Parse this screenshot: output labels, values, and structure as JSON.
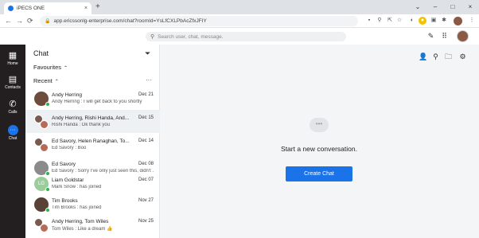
{
  "browser": {
    "tab_title": "iPECS ONE",
    "tab_close": "×",
    "new_tab": "+",
    "url": "app.ericssonlg-enterprise.com/chat?roomId=YsLfCXLPbAcZfxJFIY",
    "window_controls": [
      "⌄",
      "–",
      "□",
      "×"
    ]
  },
  "header": {
    "search_placeholder": "Search user, chat, message."
  },
  "rail": {
    "items": [
      {
        "label": "Home",
        "icon": "grid-icon"
      },
      {
        "label": "Contacts",
        "icon": "contacts-icon"
      },
      {
        "label": "Calls",
        "icon": "phone-icon"
      },
      {
        "label": "Chat",
        "icon": "chat-icon"
      }
    ]
  },
  "panel": {
    "title": "Chat",
    "favourites_label": "Favourites",
    "recent_label": "Recent",
    "more": "···"
  },
  "chats": [
    {
      "name": "Andy Herring",
      "date": "Dec 21",
      "message": "Andy Herring : I will get back to you shortly"
    },
    {
      "name": "Andy Herring, Rishi Handa, And...",
      "date": "Dec 15",
      "message": "Rishi Handa : Ok thank you"
    },
    {
      "name": "Ed Savory, Helen Ranaghan, To...",
      "date": "Dec 14",
      "message": "Ed Savory : Boo"
    },
    {
      "name": "Ed Savory",
      "date": "Dec 08",
      "message": "Ed Savory : Sorry I've only just seen this, didn't ..."
    },
    {
      "name": "Liam Goldstar",
      "date": "Dec 07",
      "message": "Mark Snow : has joined",
      "initials": "LG"
    },
    {
      "name": "Tim Brooks",
      "date": "Nov 27",
      "message": "Tim Brooks : has joined"
    },
    {
      "name": "Andy Herring, Tom Wiles",
      "date": "Nov 25",
      "message": "Tom Wiles : Like a dream 👍"
    }
  ],
  "main": {
    "empty_title": "Start a new conversation.",
    "create_button": "Create Chat"
  },
  "colors": {
    "accent": "#1a73e8",
    "rail_bg": "#231f20",
    "online": "#2fb344"
  }
}
